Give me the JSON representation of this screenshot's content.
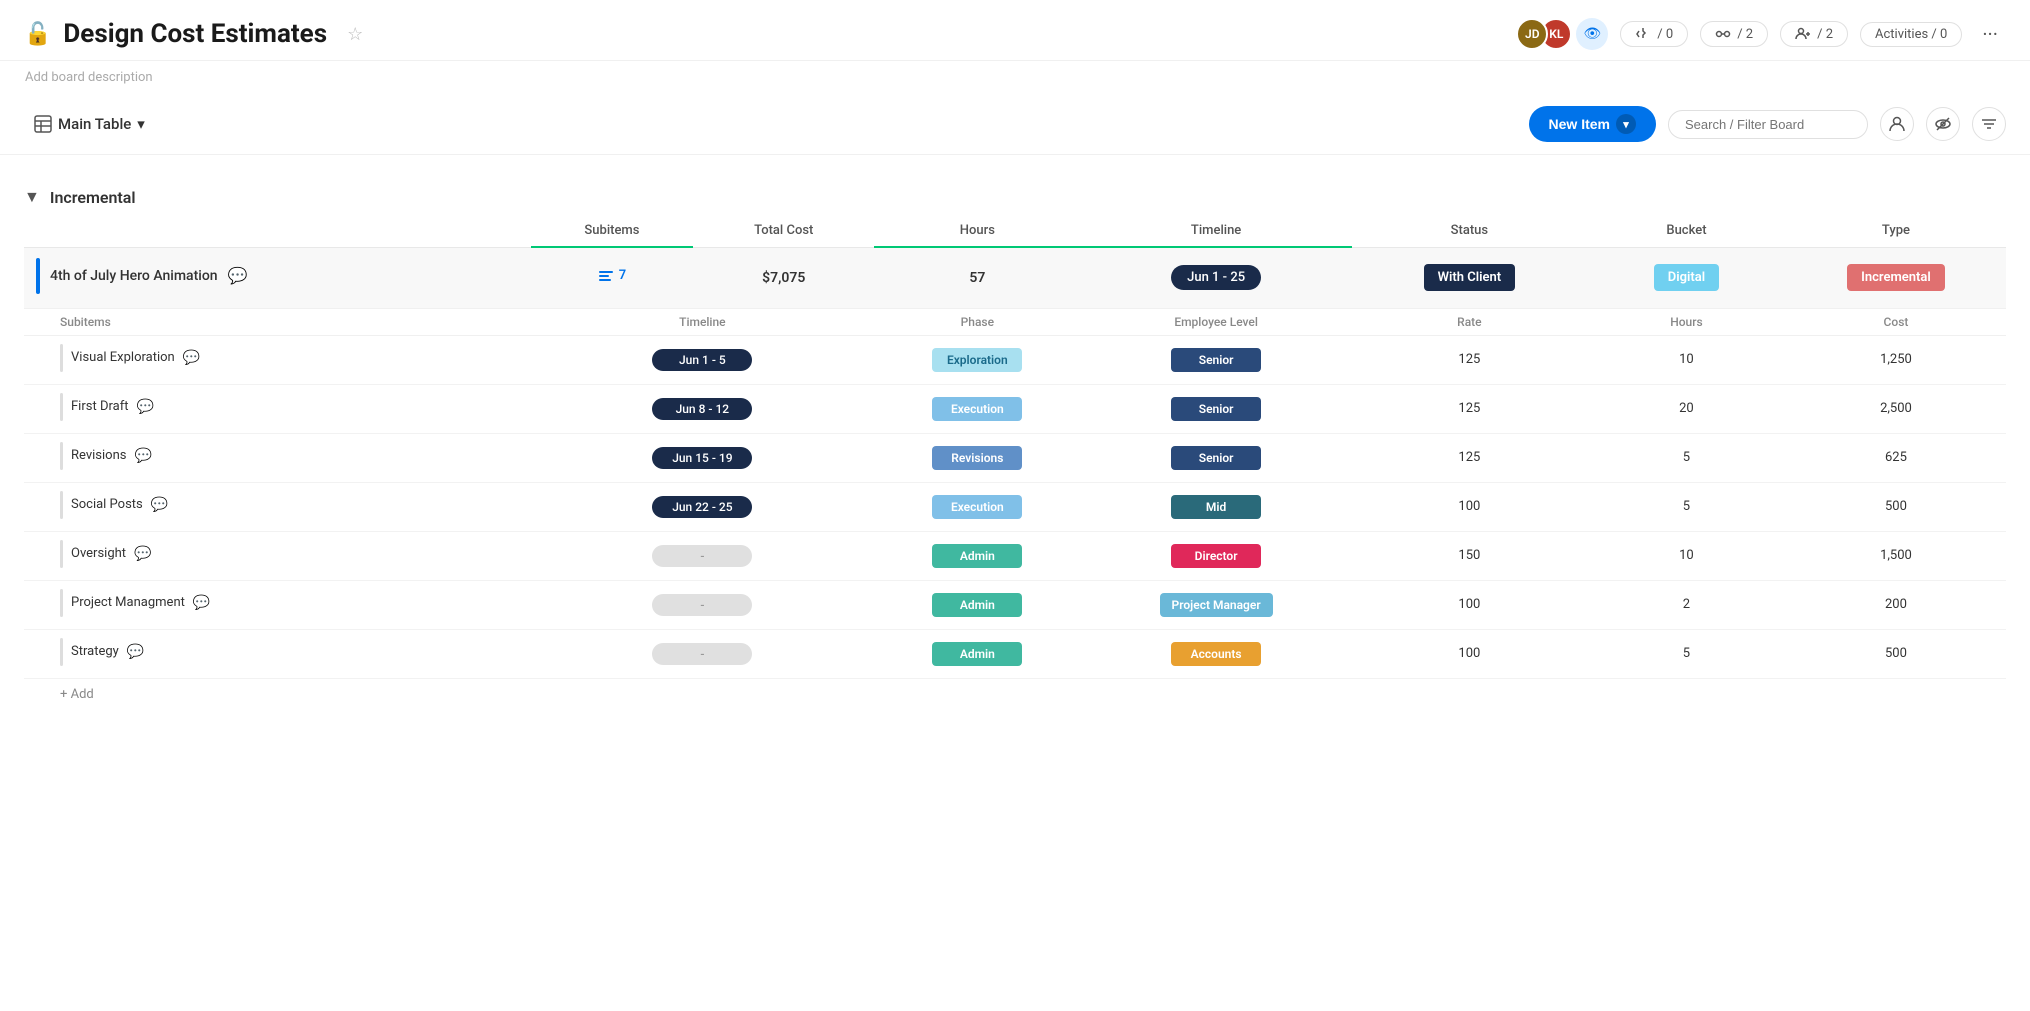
{
  "header": {
    "title": "Design Cost Estimates",
    "description_placeholder": "Add board description",
    "lock_icon": "🔒",
    "star_icon": "★",
    "stats": [
      {
        "id": "automations",
        "icon": "auto",
        "value": "/ 0"
      },
      {
        "id": "integrations",
        "icon": "integ",
        "value": "/ 2"
      },
      {
        "id": "invite",
        "icon": "invite",
        "value": "/ 2"
      },
      {
        "id": "activities",
        "label": "Activities / 0"
      }
    ],
    "more_label": "···"
  },
  "toolbar": {
    "main_table_label": "Main Table",
    "new_item_label": "New Item",
    "search_placeholder": "Search / Filter Board"
  },
  "group": {
    "name": "Incremental",
    "main_row": {
      "name": "4th of July Hero Animation",
      "subitems_count": "7",
      "total_cost": "$7,075",
      "hours": "57",
      "timeline": "Jun 1 - 25",
      "status": "With Client",
      "bucket": "Digital",
      "type": "Incremental"
    },
    "subitems_header": {
      "name_col": "Subitems",
      "timeline_col": "Timeline",
      "phase_col": "Phase",
      "level_col": "Employee Level",
      "rate_col": "Rate",
      "hours_col": "Hours",
      "cost_col": "Cost",
      "add_col": "+"
    },
    "subitems": [
      {
        "name": "Visual Exploration",
        "timeline": "Jun 1 - 5",
        "phase": "Exploration",
        "phase_class": "exploration",
        "level": "Senior",
        "level_class": "senior",
        "rate": "125",
        "hours": "10",
        "cost": "1,250"
      },
      {
        "name": "First Draft",
        "timeline": "Jun 8 - 12",
        "phase": "Execution",
        "phase_class": "execution",
        "level": "Senior",
        "level_class": "senior",
        "rate": "125",
        "hours": "20",
        "cost": "2,500"
      },
      {
        "name": "Revisions",
        "timeline": "Jun 15 - 19",
        "phase": "Revisions",
        "phase_class": "revisions",
        "level": "Senior",
        "level_class": "senior",
        "rate": "125",
        "hours": "5",
        "cost": "625"
      },
      {
        "name": "Social Posts",
        "timeline": "Jun 22 - 25",
        "phase": "Execution",
        "phase_class": "execution",
        "level": "Mid",
        "level_class": "mid",
        "rate": "100",
        "hours": "5",
        "cost": "500"
      },
      {
        "name": "Oversight",
        "timeline": "-",
        "timeline_empty": true,
        "phase": "Admin",
        "phase_class": "admin",
        "level": "Director",
        "level_class": "director",
        "rate": "150",
        "hours": "10",
        "cost": "1,500"
      },
      {
        "name": "Project Managment",
        "timeline": "-",
        "timeline_empty": true,
        "phase": "Admin",
        "phase_class": "admin",
        "level": "Project Manager",
        "level_class": "pm",
        "rate": "100",
        "hours": "2",
        "cost": "200"
      },
      {
        "name": "Strategy",
        "timeline": "-",
        "timeline_empty": true,
        "phase": "Admin",
        "phase_class": "admin",
        "level": "Accounts",
        "level_class": "accounts",
        "rate": "100",
        "hours": "5",
        "cost": "500"
      }
    ],
    "add_label": "+ Add"
  },
  "main_cols": {
    "subitems": "Subitems",
    "total_cost": "Total Cost",
    "hours": "Hours",
    "timeline": "Timeline",
    "status": "Status",
    "bucket": "Bucket",
    "type": "Type"
  }
}
